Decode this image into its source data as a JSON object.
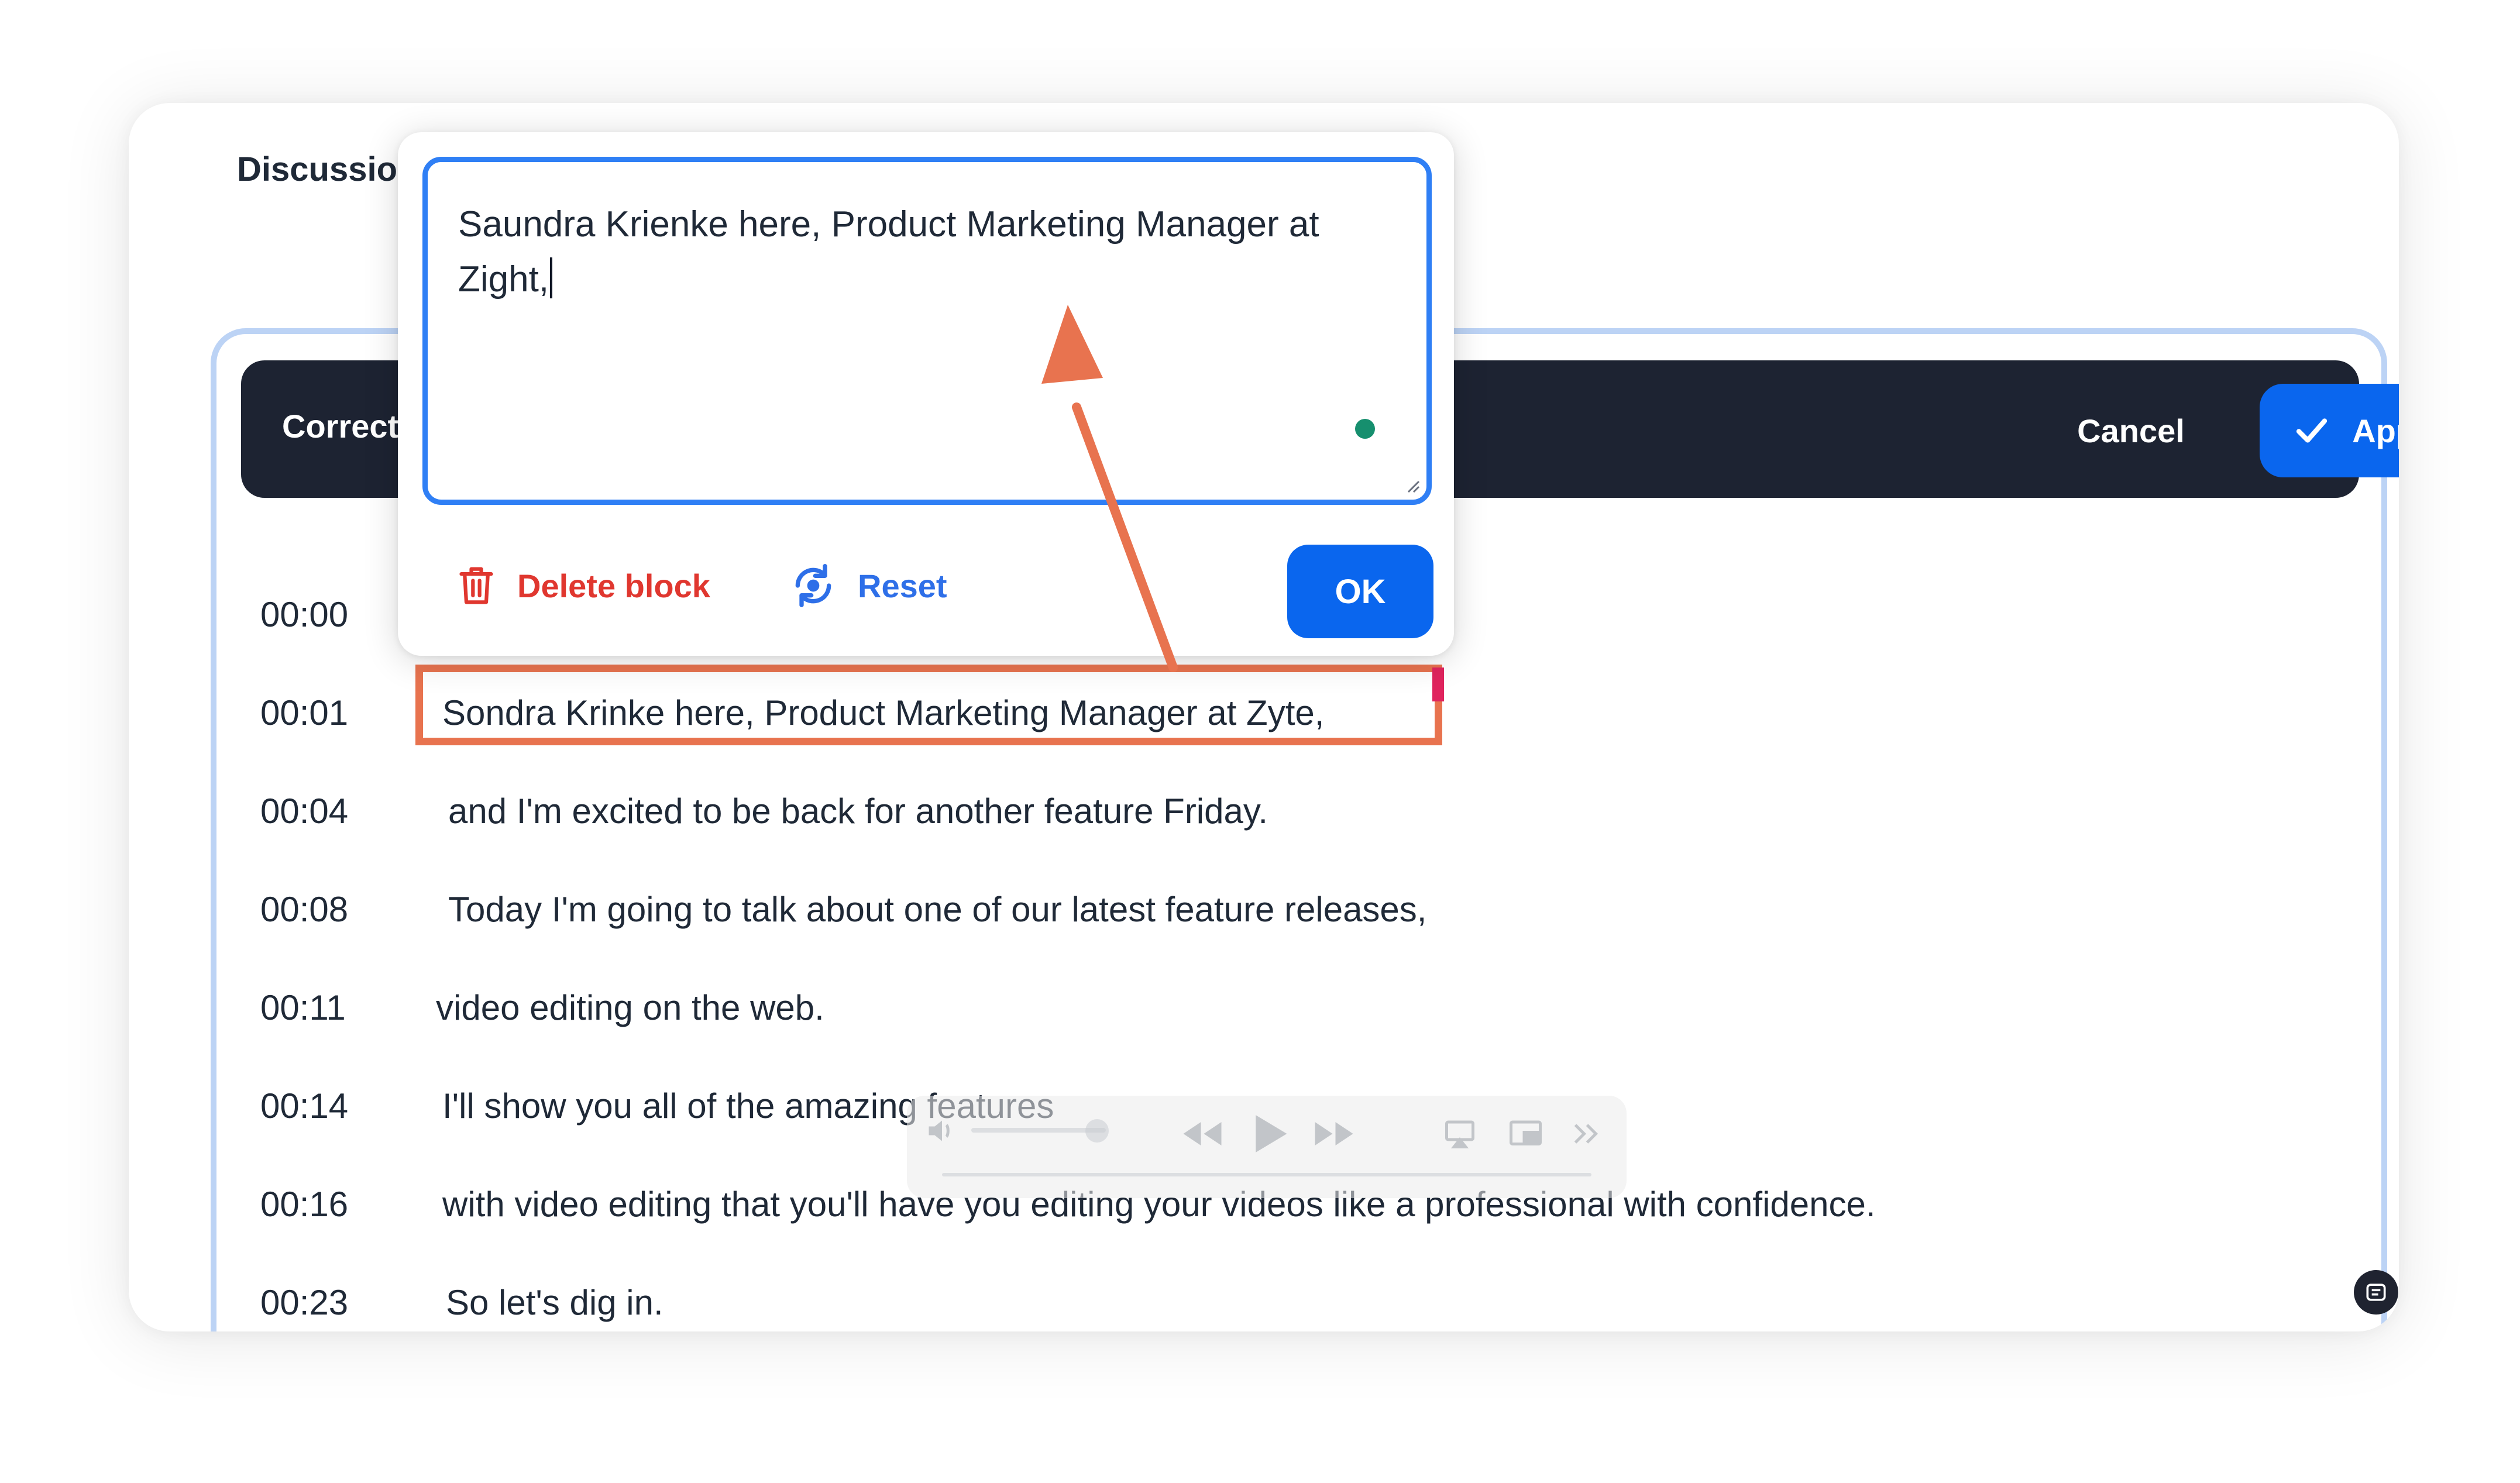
{
  "section_title": "Discussion",
  "toolbar": {
    "title": "Corrections",
    "cancel_label": "Cancel",
    "apply_label": "Apply"
  },
  "editor_popover": {
    "text": "Saundra Krienke here, Product Marketing Manager at Zight,",
    "delete_label": "Delete block",
    "reset_label": "Reset",
    "ok_label": "OK"
  },
  "transcript": [
    {
      "time": "00:00",
      "text": ""
    },
    {
      "time": "00:01",
      "text": "Sondra Krinke here, Product Marketing Manager at Zyte,"
    },
    {
      "time": "00:04",
      "text": "and I'm excited to be back for another feature Friday."
    },
    {
      "time": "00:08",
      "text": "Today I'm going to talk about one of our latest feature releases,"
    },
    {
      "time": "00:11",
      "text": "video editing on the web."
    },
    {
      "time": "00:14",
      "text": "I'll show you all of the amazing features"
    },
    {
      "time": "00:16",
      "text": "with video editing that you'll have you editing your videos like a professional with confidence."
    },
    {
      "time": "00:23",
      "text": "So let's dig in."
    }
  ],
  "colors": {
    "accent": "#0a66ee",
    "toolbar_bg": "#1d2332",
    "delete": "#e0372f",
    "reset": "#2e6fe8",
    "annotation": "#e8734f",
    "status_dot": "#168f6e"
  },
  "icons": [
    "check-icon",
    "trash-icon",
    "reset-icon",
    "volume-icon",
    "rewind-icon",
    "play-icon",
    "fast-forward-icon",
    "airplay-icon",
    "pip-icon",
    "skip-icon",
    "transcript-badge-icon"
  ]
}
